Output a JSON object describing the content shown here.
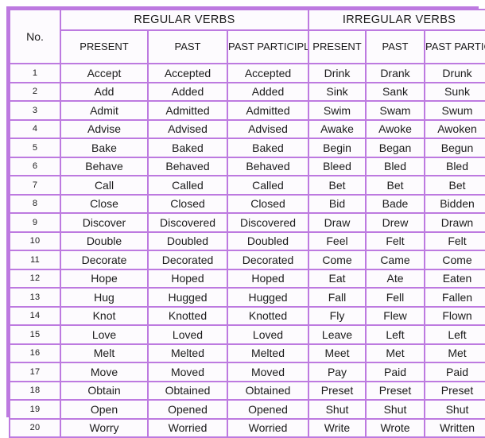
{
  "table": {
    "no_header": "No.",
    "groups": [
      {
        "label": "REGULAR VERBS"
      },
      {
        "label": "IRREGULAR VERBS"
      }
    ],
    "sub_headers": [
      "PRESENT",
      "PAST",
      "PAST PARTICIPLE",
      "PRESENT",
      "PAST",
      "PAST PARTICIPLE"
    ],
    "rows": [
      {
        "no": "1",
        "reg_present": "Accept",
        "reg_past": "Accepted",
        "reg_pp": "Accepted",
        "irr_present": "Drink",
        "irr_past": "Drank",
        "irr_pp": "Drunk"
      },
      {
        "no": "2",
        "reg_present": "Add",
        "reg_past": "Added",
        "reg_pp": "Added",
        "irr_present": "Sink",
        "irr_past": "Sank",
        "irr_pp": "Sunk"
      },
      {
        "no": "3",
        "reg_present": "Admit",
        "reg_past": "Admitted",
        "reg_pp": "Admitted",
        "irr_present": "Swim",
        "irr_past": "Swam",
        "irr_pp": "Swum"
      },
      {
        "no": "4",
        "reg_present": "Advise",
        "reg_past": "Advised",
        "reg_pp": "Advised",
        "irr_present": "Awake",
        "irr_past": "Awoke",
        "irr_pp": "Awoken"
      },
      {
        "no": "5",
        "reg_present": "Bake",
        "reg_past": "Baked",
        "reg_pp": "Baked",
        "irr_present": "Begin",
        "irr_past": "Began",
        "irr_pp": "Begun"
      },
      {
        "no": "6",
        "reg_present": "Behave",
        "reg_past": "Behaved",
        "reg_pp": "Behaved",
        "irr_present": "Bleed",
        "irr_past": "Bled",
        "irr_pp": "Bled"
      },
      {
        "no": "7",
        "reg_present": "Call",
        "reg_past": "Called",
        "reg_pp": "Called",
        "irr_present": "Bet",
        "irr_past": "Bet",
        "irr_pp": "Bet"
      },
      {
        "no": "8",
        "reg_present": "Close",
        "reg_past": "Closed",
        "reg_pp": "Closed",
        "irr_present": "Bid",
        "irr_past": "Bade",
        "irr_pp": "Bidden"
      },
      {
        "no": "9",
        "reg_present": "Discover",
        "reg_past": "Discovered",
        "reg_pp": "Discovered",
        "irr_present": "Draw",
        "irr_past": "Drew",
        "irr_pp": "Drawn"
      },
      {
        "no": "10",
        "reg_present": "Double",
        "reg_past": "Doubled",
        "reg_pp": "Doubled",
        "irr_present": "Feel",
        "irr_past": "Felt",
        "irr_pp": "Felt"
      },
      {
        "no": "11",
        "reg_present": "Decorate",
        "reg_past": "Decorated",
        "reg_pp": "Decorated",
        "irr_present": "Come",
        "irr_past": "Came",
        "irr_pp": "Come"
      },
      {
        "no": "12",
        "reg_present": "Hope",
        "reg_past": "Hoped",
        "reg_pp": "Hoped",
        "irr_present": "Eat",
        "irr_past": "Ate",
        "irr_pp": "Eaten"
      },
      {
        "no": "13",
        "reg_present": "Hug",
        "reg_past": "Hugged",
        "reg_pp": "Hugged",
        "irr_present": "Fall",
        "irr_past": "Fell",
        "irr_pp": "Fallen"
      },
      {
        "no": "14",
        "reg_present": "Knot",
        "reg_past": "Knotted",
        "reg_pp": "Knotted",
        "irr_present": "Fly",
        "irr_past": "Flew",
        "irr_pp": "Flown"
      },
      {
        "no": "15",
        "reg_present": "Love",
        "reg_past": "Loved",
        "reg_pp": "Loved",
        "irr_present": "Leave",
        "irr_past": "Left",
        "irr_pp": "Left"
      },
      {
        "no": "16",
        "reg_present": "Melt",
        "reg_past": "Melted",
        "reg_pp": "Melted",
        "irr_present": "Meet",
        "irr_past": "Met",
        "irr_pp": "Met"
      },
      {
        "no": "17",
        "reg_present": "Move",
        "reg_past": "Moved",
        "reg_pp": "Moved",
        "irr_present": "Pay",
        "irr_past": "Paid",
        "irr_pp": "Paid"
      },
      {
        "no": "18",
        "reg_present": "Obtain",
        "reg_past": "Obtained",
        "reg_pp": "Obtained",
        "irr_present": "Preset",
        "irr_past": "Preset",
        "irr_pp": "Preset"
      },
      {
        "no": "19",
        "reg_present": "Open",
        "reg_past": "Opened",
        "reg_pp": "Opened",
        "irr_present": "Shut",
        "irr_past": "Shut",
        "irr_pp": "Shut"
      },
      {
        "no": "20",
        "reg_present": "Worry",
        "reg_past": "Worried",
        "reg_pp": "Worried",
        "irr_present": "Write",
        "irr_past": "Wrote",
        "irr_pp": "Written"
      }
    ]
  },
  "colors": {
    "border": "#bd7ae0",
    "banner_fill": "#eedcf8",
    "no_header_fill": "#f3e3fb",
    "cell_fill": "#fdfbfe",
    "text": "#1b1b1b"
  }
}
